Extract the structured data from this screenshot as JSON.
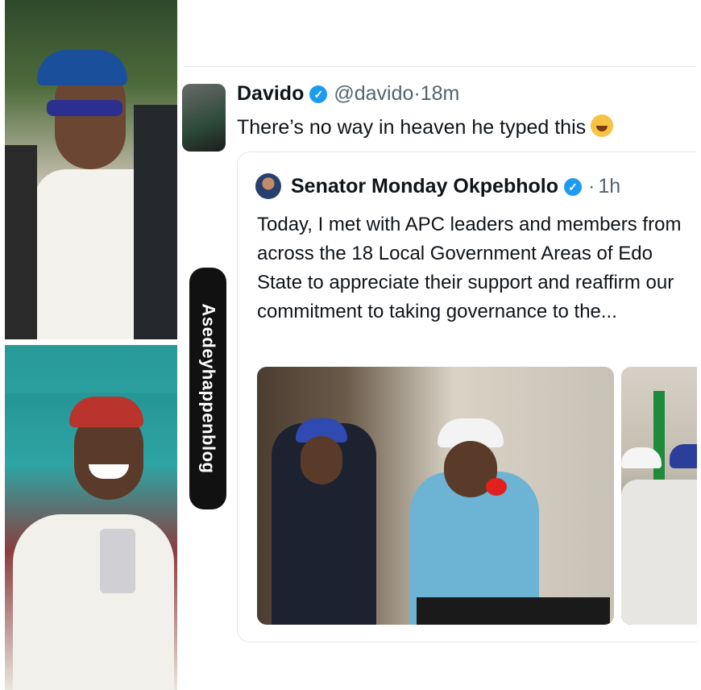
{
  "watermark": "Asedeyhappenblog",
  "tweet": {
    "name": "Davido",
    "handle": "@davido",
    "separator": "·",
    "time": "18m",
    "text": "There’s no way in heaven he typed this",
    "emoji": "face-with-tears-of-joy-emoji",
    "verified_color": "#1d9bf0"
  },
  "quoted_tweet": {
    "name": "Senator Monday Okpebholo",
    "separator": "·",
    "time": "1h",
    "text": "Today, I met with APC leaders and members from across the 18 Local Government Areas of Edo State to appreciate their support and reaffirm our commitment to taking governance to the..."
  },
  "images": {
    "left_top": "photo of man in blue cap and white kaftan",
    "left_bottom": "photo of smiling man in red cap with chains",
    "quote_main": "photo of man speaking into red microphone beside police officer",
    "quote_second": "photo of men seated at event"
  }
}
